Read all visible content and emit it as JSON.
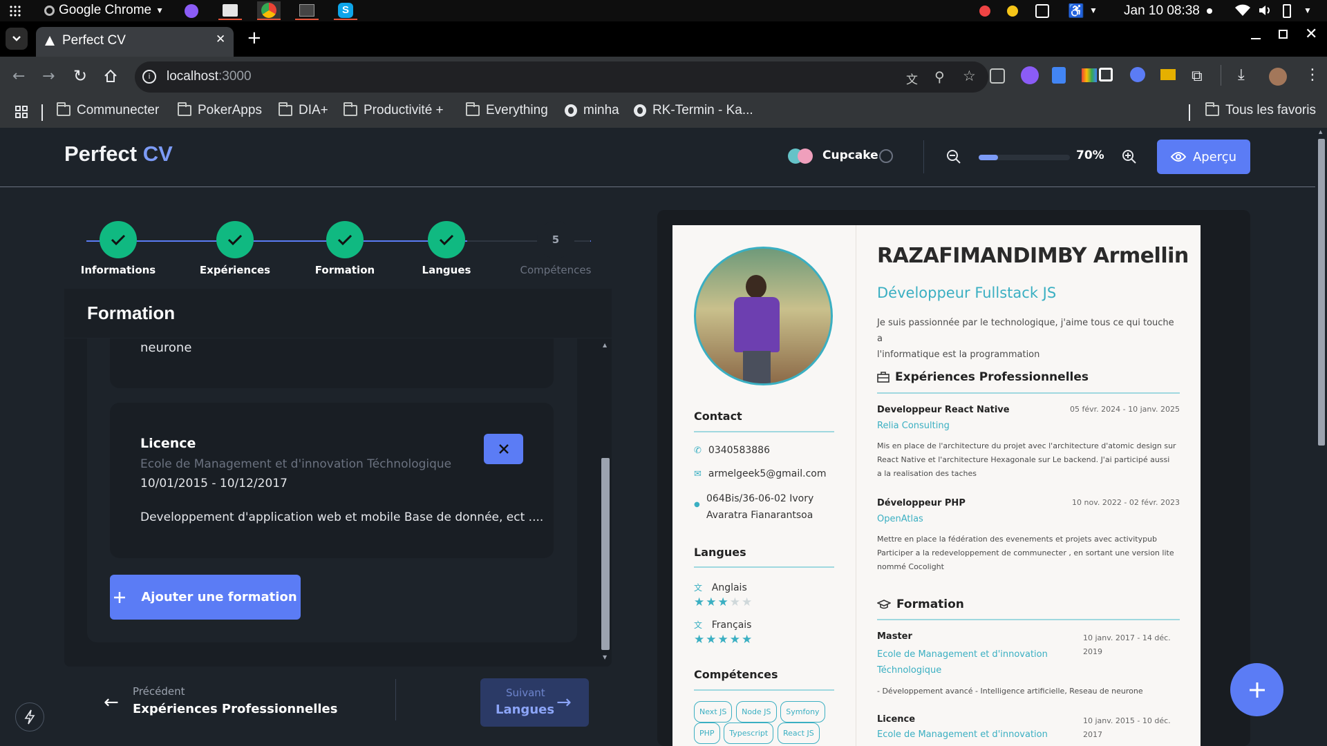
{
  "system": {
    "app_name": "Google Chrome",
    "datetime": "Jan 10  08:38"
  },
  "browser": {
    "tab_title": "Perfect CV",
    "url_host": "localhost",
    "url_port": ":3000",
    "bookmarks": [
      "Communecter",
      "PokerApps",
      "DIA+",
      "Productivité +",
      "Everything",
      "minha",
      "RK-Termin - Ka..."
    ],
    "all_bookmarks": "Tous les favoris"
  },
  "app": {
    "brand_main": "Perfect ",
    "brand_accent": "CV",
    "theme_name": "Cupcake",
    "zoom": "70%",
    "zoom_fraction": 0.7,
    "preview_label": "Aperçu"
  },
  "steps": [
    {
      "label": "Informations",
      "done": true
    },
    {
      "label": "Expériences",
      "done": true
    },
    {
      "label": "Formation",
      "done": true
    },
    {
      "label": "Langues",
      "done": true
    },
    {
      "label": "Compétences",
      "number": "5",
      "done": false
    }
  ],
  "form": {
    "title": "Formation",
    "prev_entry_tail": "neurone",
    "entry": {
      "degree": "Licence",
      "school": "Ecole de Management et d'innovation Téchnologique",
      "dates": "10/01/2015 - 10/12/2017",
      "description": "Developpement d'application web et mobile Base de donnée, ect ...."
    },
    "add_label": "Ajouter une formation"
  },
  "nav": {
    "prev_hint": "Précédent",
    "prev_label": "Expériences Professionnelles",
    "next_hint": "Suivant",
    "next_label": "Langues"
  },
  "cv": {
    "name": "RAZAFIMANDIMBY Armellin",
    "title": "Développeur Fullstack JS",
    "summary_1": "Je suis passionnée par le technologique, j'aime tous ce qui touche a",
    "summary_2": "l'informatique est la programmation",
    "contact_title": "Contact",
    "phone": "0340583886",
    "email": "armelgeek5@gmail.com",
    "address_1": "064Bis/36-06-02 Ivory",
    "address_2": "Avaratra Fianarantsoa",
    "languages_title": "Langues",
    "languages": [
      {
        "name": "Anglais",
        "stars": 3
      },
      {
        "name": "Français",
        "stars": 5
      }
    ],
    "skills_title": "Compétences",
    "skills": [
      "Next JS",
      "Node JS",
      "Symfony",
      "PHP",
      "Typescript",
      "React JS"
    ],
    "experience_title": "Expériences Professionnelles",
    "experiences": [
      {
        "role": "Developpeur React Native",
        "company": "Relia Consulting",
        "dates": "05 févr. 2024 - 10 janv. 2025",
        "desc_1": "Mis en place de l'architecture du projet avec l'architecture d'atomic design sur",
        "desc_2": "React Native et l'architecture Hexagonale sur Le backend. J'ai participé aussi",
        "desc_3": "a la realisation des taches"
      },
      {
        "role": "Développeur PHP",
        "company": "OpenAtlas",
        "dates": "10 nov. 2022 - 02 févr. 2023",
        "desc_1": "Mettre en place la fédération des evenements et projets avec activitypub",
        "desc_2": "Participer a la redeveloppement de communecter , en sortant une version lite",
        "desc_3": "nommé Cocolight"
      }
    ],
    "education_title": "Formation",
    "education": [
      {
        "degree": "Master",
        "school_1": "Ecole de Management et d'innovation",
        "school_2": "Téchnologique",
        "dates_1": "10 janv. 2017 - 14 déc.",
        "dates_2": "2019",
        "desc": "- Développement avancé - Intelligence artificielle, Reseau de neurone"
      },
      {
        "degree": "Licence",
        "school_1": "Ecole de Management et d'innovation",
        "dates_1": "10 janv. 2015 - 10 déc.",
        "dates_2": "2017"
      }
    ]
  },
  "colors": {
    "accent": "#5b7cf5",
    "success": "#10b981",
    "teal": "#3aafc2",
    "background": "#1d232a"
  }
}
